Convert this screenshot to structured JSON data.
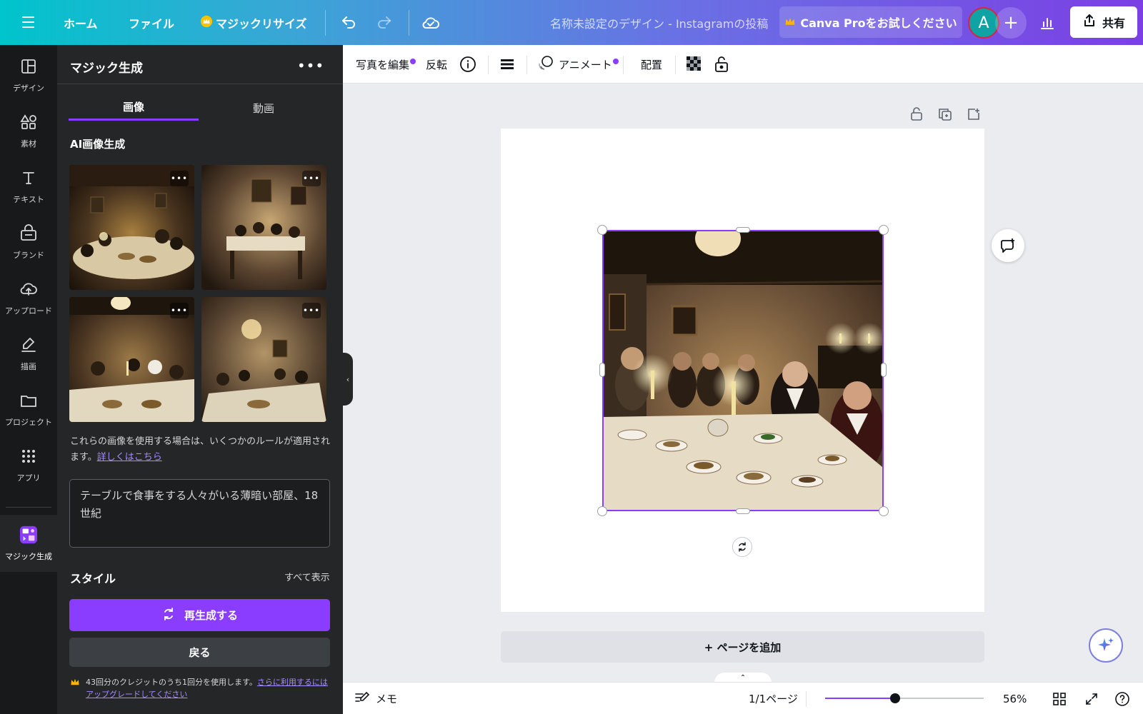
{
  "topbar": {
    "menu_home": "ホーム",
    "menu_file": "ファイル",
    "menu_magic_resize": "マジックリサイズ",
    "doc_title": "名称未設定のデザイン - Instagramの投稿",
    "pro_button": "Canva Proをお試しください",
    "avatar_initial": "A",
    "share_label": "共有"
  },
  "rail": {
    "items": [
      {
        "label": "デザイン",
        "icon": "layout-icon"
      },
      {
        "label": "素材",
        "icon": "shapes-icon"
      },
      {
        "label": "テキスト",
        "icon": "text-icon"
      },
      {
        "label": "ブランド",
        "icon": "brand-icon"
      },
      {
        "label": "アップロード",
        "icon": "cloud-upload-icon"
      },
      {
        "label": "描画",
        "icon": "draw-icon"
      },
      {
        "label": "プロジェクト",
        "icon": "folder-icon"
      },
      {
        "label": "アプリ",
        "icon": "apps-grid-icon"
      },
      {
        "label": "マジック生成",
        "icon": "magic-media-icon"
      }
    ]
  },
  "panel": {
    "title": "マジック生成",
    "tabs": [
      {
        "label": "画像",
        "active": true
      },
      {
        "label": "動画",
        "active": false
      }
    ],
    "section_title": "AI画像生成",
    "rules_text": "これらの画像を使用する場合は、いくつかのルールが適用されます。",
    "rules_link": "詳しくはこちら",
    "prompt_text": "テーブルで食事をする人々がいる薄暗い部屋、18世紀",
    "style_title": "スタイル",
    "style_show_all": "すべて表示",
    "regenerate_label": "再生成する",
    "back_label": "戻る",
    "credit_text": "43回分のクレジットのうち1回分を使用します。",
    "credit_link": "さらに利用するにはアップグレードしてください"
  },
  "context_toolbar": {
    "edit_photo": "写真を編集",
    "flip": "反転",
    "animate": "アニメート",
    "position": "配置"
  },
  "canvas": {
    "add_page": "+ ページを追加"
  },
  "footer": {
    "notes": "メモ",
    "page_indicator": "1/1ページ",
    "zoom": "56%",
    "zoom_level": 0.44
  },
  "colors": {
    "accent": "#8b3dff",
    "panel_bg": "#252627",
    "rail_bg": "#18191b",
    "canvas_bg": "#ebecf0"
  }
}
